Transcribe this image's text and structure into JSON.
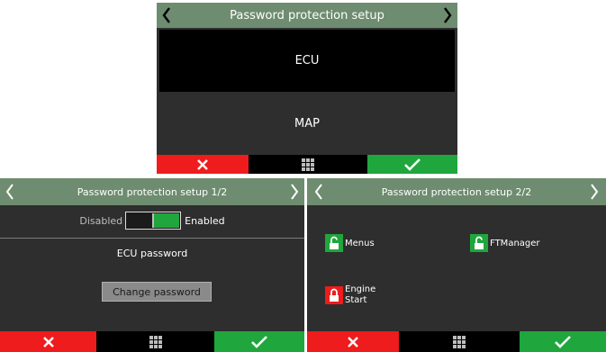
{
  "screen1": {
    "title": "Password protection setup",
    "items": [
      {
        "label": "ECU"
      },
      {
        "label": "MAP"
      }
    ]
  },
  "screen2": {
    "title": "Password protection setup 1/2",
    "toggle": {
      "off_label": "Disabled",
      "on_label": "Enabled",
      "state": "enabled"
    },
    "section_label": "ECU password",
    "change_button_label": "Change password"
  },
  "screen3": {
    "title": "Password protection setup 2/2",
    "locks": [
      {
        "label": "Menus",
        "state": "unlocked",
        "color": "#1fa63c"
      },
      {
        "label": "FTManager",
        "state": "unlocked",
        "color": "#1fa63c"
      },
      {
        "label": "Engine\nStart",
        "state": "locked",
        "color": "#ee1c1c"
      }
    ]
  },
  "colors": {
    "header": "#6e8c6f",
    "cancel": "#ee1c1c",
    "confirm": "#1fa63c",
    "selected_item_bg": "#000000",
    "panel_bg": "#2e2e2e"
  },
  "icons": {
    "back": "chevron-left-icon",
    "forward": "chevron-right-icon",
    "cancel": "x-icon",
    "menu": "grid-menu-icon",
    "confirm": "checkmark-icon",
    "unlocked": "unlocked-padlock-icon",
    "locked": "locked-padlock-icon"
  }
}
